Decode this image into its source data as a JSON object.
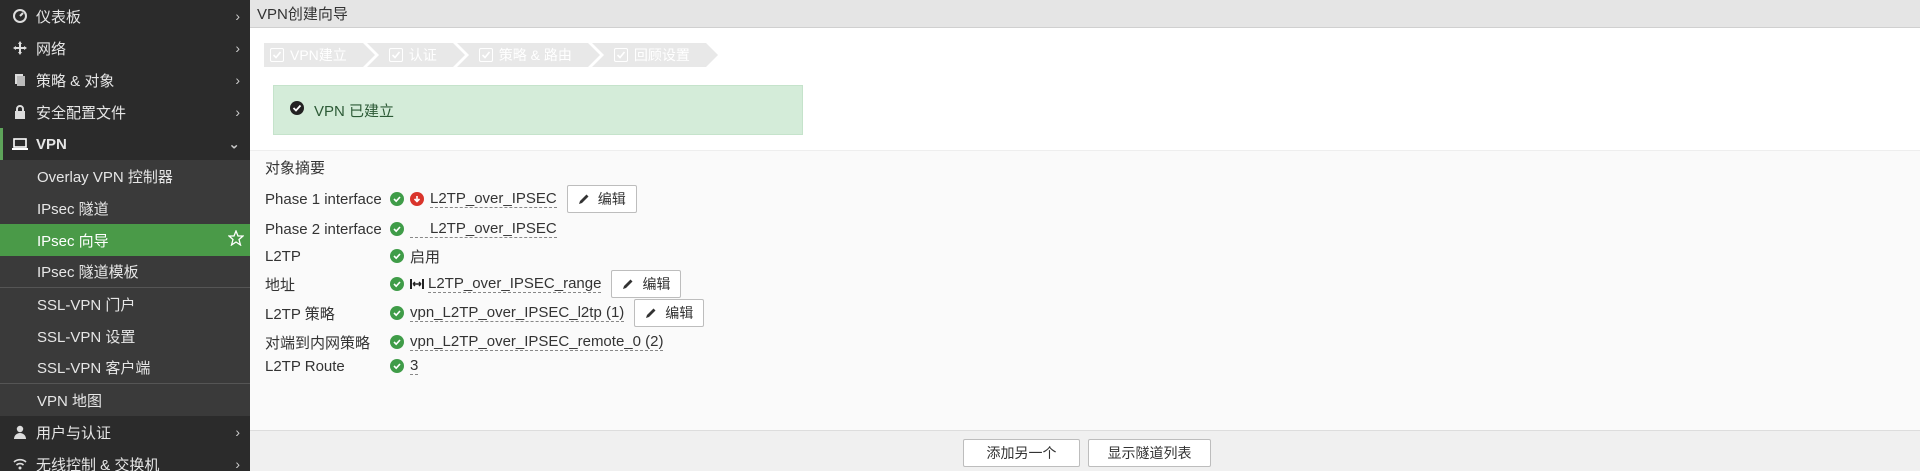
{
  "sidebar": {
    "items": [
      {
        "label": "仪表板",
        "icon": "dashboard-icon"
      },
      {
        "label": "网络",
        "icon": "network-move-icon"
      },
      {
        "label": "策略 & 对象",
        "icon": "policy-icon"
      },
      {
        "label": "安全配置文件",
        "icon": "lock-icon"
      },
      {
        "label": "VPN",
        "icon": "laptop-icon"
      },
      {
        "label": "Overlay VPN 控制器"
      },
      {
        "label": "IPsec 隧道"
      },
      {
        "label": "IPsec 向导"
      },
      {
        "label": "IPsec 隧道模板"
      },
      {
        "label": "SSL-VPN 门户"
      },
      {
        "label": "SSL-VPN 设置"
      },
      {
        "label": "SSL-VPN 客户端"
      },
      {
        "label": "VPN 地图"
      },
      {
        "label": "用户与认证",
        "icon": "user-icon"
      },
      {
        "label": "无线控制 & 交换机",
        "icon": "wifi-icon"
      }
    ]
  },
  "header": {
    "title": "VPN创建向导"
  },
  "wizard": {
    "steps": [
      "VPN建立",
      "认证",
      "策略 & 路由",
      "回顾设置"
    ]
  },
  "alert": {
    "text": "VPN 已建立"
  },
  "summary": {
    "title": "对象摘要",
    "rows": [
      {
        "label": "Phase 1 interface",
        "value": "L2TP_over_IPSEC",
        "edit": "编辑"
      },
      {
        "label": "Phase 2 interface",
        "value": "L2TP_over_IPSEC"
      },
      {
        "label": "L2TP",
        "value": "启用"
      },
      {
        "label": "地址",
        "value": "L2TP_over_IPSEC_range",
        "edit": "编辑"
      },
      {
        "label": "L2TP 策略",
        "value": "vpn_L2TP_over_IPSEC_l2tp (1)",
        "edit": "编辑"
      },
      {
        "label": "对端到内网策略",
        "value": "vpn_L2TP_over_IPSEC_remote_0 (2)"
      },
      {
        "label": "L2TP Route",
        "value": "3"
      }
    ]
  },
  "footer": {
    "add_another": "添加另一个",
    "show_tunnels": "显示隧道列表"
  },
  "colors": {
    "sidebar_bg": "#2b2b2b",
    "active_green": "#4a9a48",
    "success_bg": "#d4ecd9",
    "check_green": "#3f9c48",
    "error_red": "#d9342b"
  }
}
